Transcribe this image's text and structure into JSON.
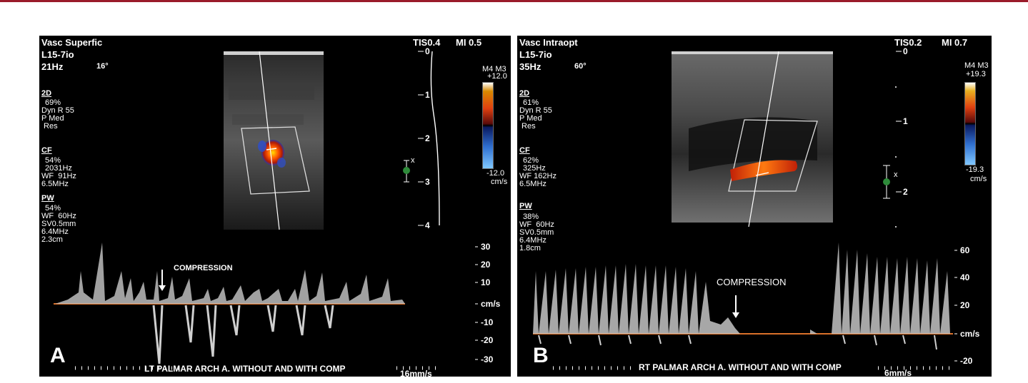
{
  "colors": {
    "top_bar": "#9a1b2a",
    "panel_bg": "#000000",
    "baseline": "#d9702a",
    "text": "#ffffff"
  },
  "panel_a": {
    "letter": "A",
    "header": {
      "mode": "Vasc Superfic",
      "probe": "L15-7io",
      "frame_rate": "21Hz",
      "angle": "16°",
      "tis": "TIS0.4",
      "mi": "MI 0.5"
    },
    "params_2d": {
      "label": "2D",
      "lines": [
        "69%",
        "Dyn R 55",
        "P Med",
        " Res"
      ]
    },
    "params_cf": {
      "label": "CF",
      "lines": [
        "54%",
        "2031Hz",
        "WF  91Hz",
        "6.5MHz"
      ]
    },
    "params_pw": {
      "label": "PW",
      "lines": [
        "54%",
        "WF  60Hz",
        "SV0.5mm",
        "6.4MHz",
        "2.3cm"
      ]
    },
    "color_bar": {
      "mode": "M4 M3",
      "max": "+12.0",
      "min": "-12.0",
      "unit": "cm/s"
    },
    "depth_ticks": [
      "0",
      "1",
      "2",
      "3",
      "4"
    ],
    "velocity_ticks": [
      "30",
      "20",
      "10",
      "cm/s",
      "-10",
      "-20",
      "-30"
    ],
    "annotation": "COMPRESSION",
    "sweep_speed": "16mm/s",
    "caption": "LT PALMAR ARCH A. WITHOUT AND WITH COMP"
  },
  "panel_b": {
    "letter": "B",
    "header": {
      "mode": "Vasc Intraopt",
      "probe": "L15-7io",
      "frame_rate": "35Hz",
      "angle": "60°",
      "tis": "TIS0.2",
      "mi": "MI 0.7"
    },
    "params_2d": {
      "label": "2D",
      "lines": [
        "61%",
        "Dyn R 55",
        "P Med",
        " Res"
      ]
    },
    "params_cf": {
      "label": "CF",
      "lines": [
        "62%",
        "325Hz",
        "WF 162Hz",
        "6.5MHz"
      ]
    },
    "params_pw": {
      "label": "PW",
      "lines": [
        "38%",
        "WF  60Hz",
        "SV0.5mm",
        "6.4MHz",
        "1.8cm"
      ]
    },
    "color_bar": {
      "mode": "M4 M3",
      "max": "+19.3",
      "min": "-19.3",
      "unit": "cm/s"
    },
    "depth_ticks": [
      "0",
      "1",
      "2"
    ],
    "velocity_ticks": [
      "60",
      "40",
      "20",
      "cm/s",
      "-20"
    ],
    "annotation": "COMPRESSION",
    "sweep_speed": "6mm/s",
    "caption": "RT PALMAR ARCH A. WITHOUT AND WITH COMP"
  }
}
